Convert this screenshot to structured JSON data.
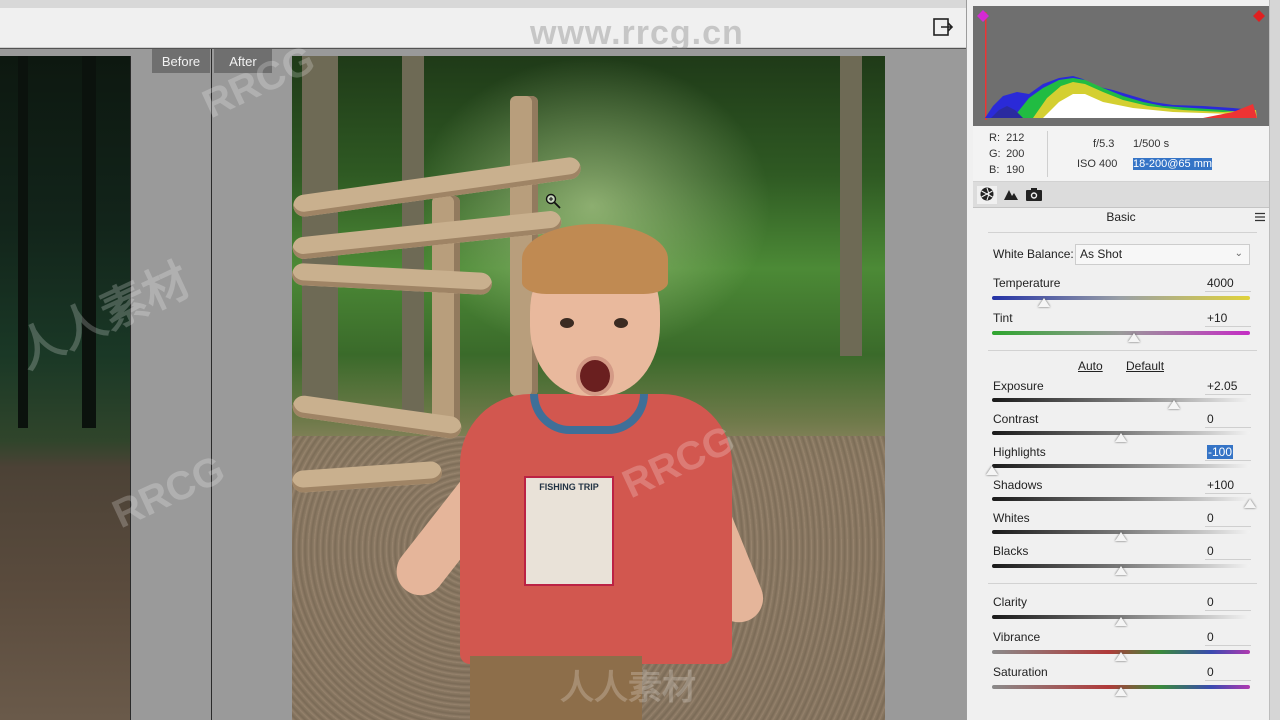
{
  "app": {
    "watermark_url": "www.rrcg.cn",
    "watermark_brand": "RRCG",
    "watermark_cn": "人人素材"
  },
  "view_tabs": {
    "before": "Before",
    "after": "After"
  },
  "readout": {
    "r_key": "R:",
    "r_val": "212",
    "g_key": "G:",
    "g_val": "200",
    "b_key": "B:",
    "b_val": "190",
    "aperture": "f/5.3",
    "shutter": "1/500 s",
    "iso": "ISO 400",
    "lens": "18-200@65 mm"
  },
  "panel": {
    "section_title": "Basic",
    "tools": [
      "aperture-icon",
      "mountain-icon",
      "camera-icon"
    ],
    "white_balance": {
      "label": "White Balance:",
      "value": "As Shot"
    },
    "temperature": {
      "label": "Temperature",
      "value": "4000"
    },
    "tint": {
      "label": "Tint",
      "value": "+10"
    },
    "auto_label": "Auto",
    "default_label": "Default",
    "exposure": {
      "label": "Exposure",
      "value": "+2.05"
    },
    "contrast": {
      "label": "Contrast",
      "value": "0"
    },
    "highlights": {
      "label": "Highlights",
      "value": "-100"
    },
    "shadows": {
      "label": "Shadows",
      "value": "+100"
    },
    "whites": {
      "label": "Whites",
      "value": "0"
    },
    "blacks": {
      "label": "Blacks",
      "value": "0"
    },
    "clarity": {
      "label": "Clarity",
      "value": "0"
    },
    "vibrance": {
      "label": "Vibrance",
      "value": "0"
    },
    "saturation": {
      "label": "Saturation",
      "value": "0"
    }
  },
  "slider_levels": {
    "temperature": 0.2,
    "tint": 0.55,
    "exposure": 0.705,
    "contrast": 0.5,
    "highlights": 0.0,
    "shadows": 1.0,
    "whites": 0.5,
    "blacks": 0.5,
    "clarity": 0.5,
    "vibrance": 0.5,
    "saturation": 0.5
  },
  "photo": {
    "shirt_text": "FISHING TRIP"
  }
}
